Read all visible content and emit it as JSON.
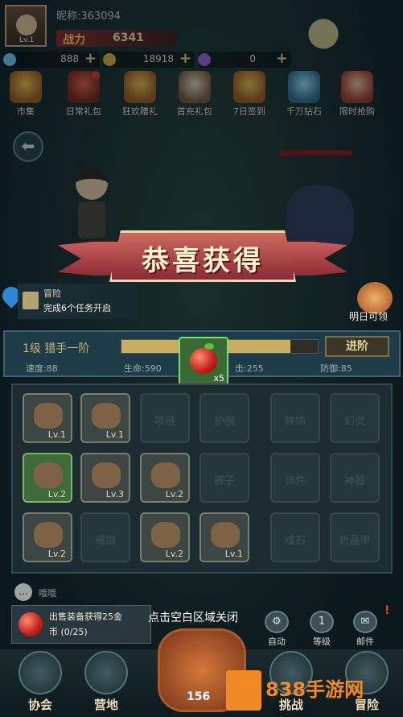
{
  "header": {
    "nickname": "昵称:363094",
    "avatar_level": "Lv.1",
    "power_label": "战力",
    "power_value": "6341",
    "resources": [
      {
        "name": "diamond-icon",
        "value": "888",
        "color": "#6fd3ff"
      },
      {
        "name": "gold-coin-icon",
        "value": "18918",
        "color": "#e0b53c"
      },
      {
        "name": "star-icon",
        "value": "0",
        "color": "#9c6bd8"
      }
    ],
    "plus": "+"
  },
  "features": [
    {
      "label": "市集",
      "icon": "market-icon",
      "badge": false
    },
    {
      "label": "日常礼包",
      "icon": "daily-gift-icon",
      "badge": true
    },
    {
      "label": "狂欢赠礼",
      "icon": "carnival-gift-icon",
      "badge": false
    },
    {
      "label": "首充礼包",
      "icon": "first-recharge-icon",
      "badge": false
    },
    {
      "label": "7日签到",
      "icon": "checkin-icon",
      "badge": false
    },
    {
      "label": "千万钻石",
      "icon": "diamond-chest-icon",
      "badge": false
    },
    {
      "label": "限时抢购",
      "icon": "flash-sale-icon",
      "badge": false
    }
  ],
  "back": "⬅",
  "banner": {
    "title": "恭喜获得"
  },
  "quest": {
    "category": "冒险",
    "task": "完成6个任务开启"
  },
  "tomorrow": "明日可领",
  "stats_panel": {
    "rank": "1级  猎手一阶",
    "exp_fraction": 0.86,
    "advance_label": "进阶",
    "speed": "速度:88",
    "hp": "生命:590",
    "attack": "击:255",
    "defense": "防御:85"
  },
  "reward": {
    "item": "apple-icon",
    "quantity": "x5"
  },
  "inventory": [
    {
      "kind": "item",
      "icon": "leather-armor-icon",
      "level": "Lv.1",
      "green": false
    },
    {
      "kind": "item",
      "icon": "helmet-icon",
      "level": "Lv.1",
      "green": false
    },
    {
      "kind": "empty",
      "label": "项链"
    },
    {
      "kind": "empty",
      "label": "护腕"
    },
    {
      "kind": "empty",
      "label": "铁饰"
    },
    {
      "kind": "empty",
      "label": "幻灵"
    },
    {
      "kind": "item",
      "icon": "chest-armor-icon",
      "level": "Lv.2",
      "green": true
    },
    {
      "kind": "item",
      "icon": "glove-icon",
      "level": "Lv.3",
      "green": false
    },
    {
      "kind": "item",
      "icon": "belt-icon",
      "level": "Lv.2",
      "green": false
    },
    {
      "kind": "empty",
      "label": "裤子"
    },
    {
      "kind": "empty",
      "label": "饰件"
    },
    {
      "kind": "empty",
      "label": "神器"
    },
    {
      "kind": "item",
      "icon": "mace-icon",
      "level": "Lv.2",
      "green": false
    },
    {
      "kind": "empty",
      "label": "戒指"
    },
    {
      "kind": "item",
      "icon": "boots-icon",
      "level": "Lv.2",
      "green": false
    },
    {
      "kind": "item",
      "icon": "shield-icon",
      "level": "Lv.1",
      "green": false
    },
    {
      "kind": "empty",
      "label": "魂石"
    },
    {
      "kind": "empty",
      "label": "析晶甲"
    }
  ],
  "chat": {
    "icon": "...",
    "text": "哦哦"
  },
  "sale": {
    "line1": "出售装备获得25金",
    "line2": "币 (0/25)"
  },
  "close_hint": "点击空白区域关闭",
  "quick_buttons": [
    {
      "label": "自动",
      "icon": "gear-icon",
      "glyph": "⚙"
    },
    {
      "label": "等级",
      "icon": "level-icon",
      "glyph": "1"
    },
    {
      "label": "邮件",
      "icon": "mail-icon",
      "glyph": "✉"
    }
  ],
  "mail_badge": "!",
  "nav": {
    "guild": "协会",
    "camp": "营地",
    "battle_count": "156",
    "challenge": "挑战",
    "adventure": "冒险"
  },
  "watermark": {
    "text": "838手游网"
  }
}
